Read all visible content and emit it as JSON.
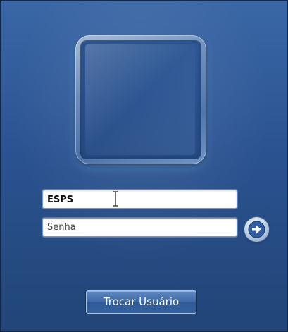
{
  "login": {
    "username_value": "ESPS",
    "password_placeholder": "Senha",
    "switch_user_label": "Trocar Usuário"
  },
  "icons": {
    "submit": "arrow-right-icon",
    "avatar": "user-picture-frame",
    "cursor": "text-cursor-icon"
  },
  "colors": {
    "background_top": "#3a67a6",
    "background_bottom": "#214577",
    "button_text": "#ffffff"
  }
}
